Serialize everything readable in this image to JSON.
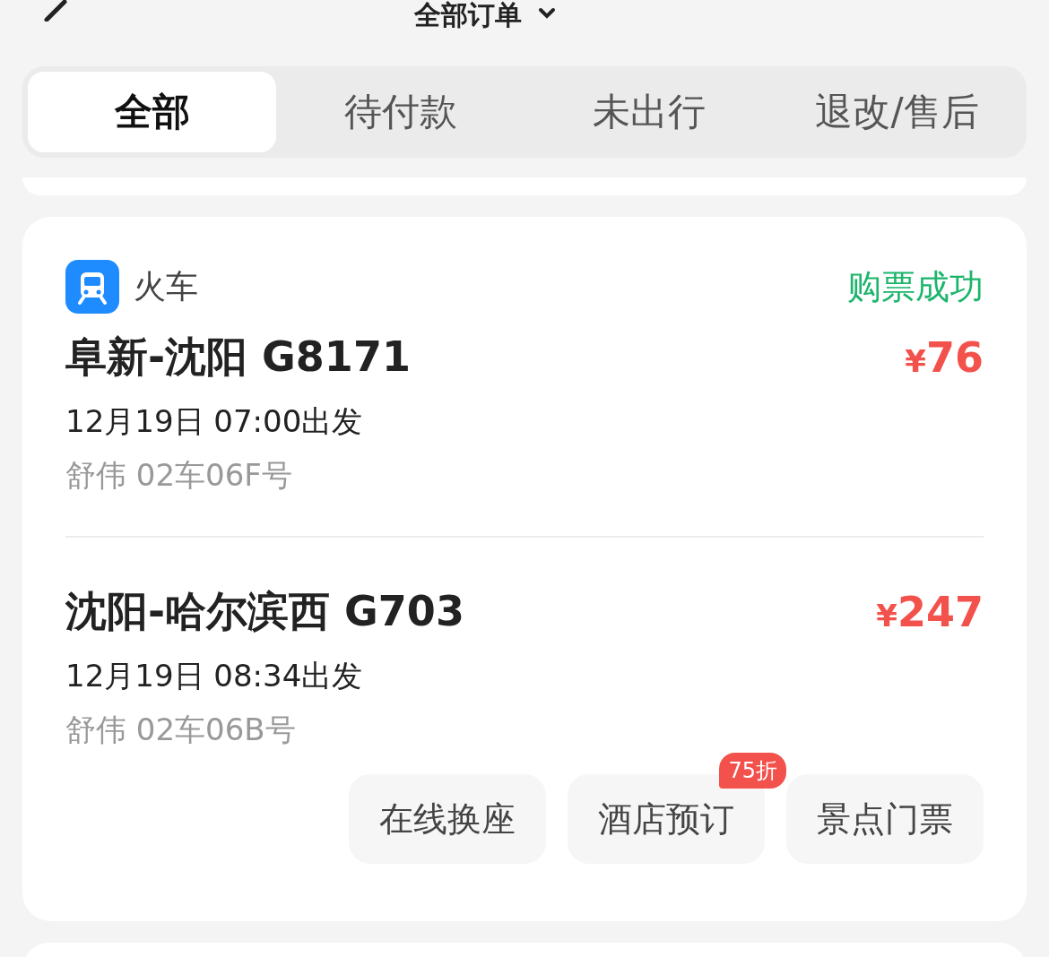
{
  "header": {
    "title": "全部订单"
  },
  "tabs": [
    {
      "label": "全部",
      "selected": true
    },
    {
      "label": "待付款",
      "selected": false
    },
    {
      "label": "未出行",
      "selected": false
    },
    {
      "label": "退改/售后",
      "selected": false
    }
  ],
  "order": {
    "category": "火车",
    "status": "购票成功",
    "trips": [
      {
        "route": "阜新-沈阳 G8171",
        "currency": "¥",
        "amount": "76",
        "departure": "12月19日 07:00出发",
        "seat": "舒伟 02车06F号"
      },
      {
        "route": "沈阳-哈尔滨西 G703",
        "currency": "¥",
        "amount": "247",
        "departure": "12月19日 08:34出发",
        "seat": "舒伟 02车06B号"
      }
    ],
    "actions": [
      {
        "label": "在线换座"
      },
      {
        "label": "酒店预订",
        "badge": "75折"
      },
      {
        "label": "景点门票"
      }
    ]
  }
}
